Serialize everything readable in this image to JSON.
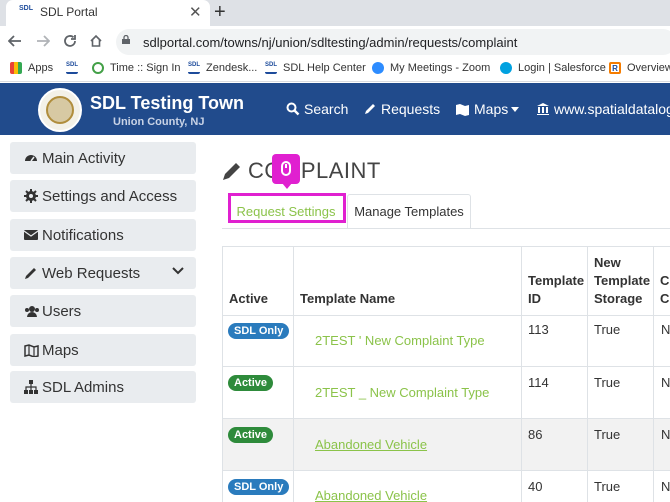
{
  "browser": {
    "tab_title": "SDL Portal",
    "tab_favicon_text": "SDL",
    "new_tab": "+",
    "close": "✕",
    "url": "sdlportal.com/towns/nj/union/sdltesting/admin/requests/complaint"
  },
  "bookmarks": [
    {
      "label": "Apps",
      "icon": "apps-grid-icon"
    },
    {
      "label": "",
      "icon": "sdl-favicon"
    },
    {
      "label": "Time :: Sign In",
      "icon": "clock-icon"
    },
    {
      "label": "Zendesk...",
      "icon": "sdl-favicon"
    },
    {
      "label": "SDL Help Center",
      "icon": "sdl-favicon"
    },
    {
      "label": "My Meetings - Zoom",
      "icon": "zoom-icon"
    },
    {
      "label": "Login | Salesforce",
      "icon": "salesforce-icon"
    },
    {
      "label": "Overview",
      "icon": "r-icon"
    }
  ],
  "site": {
    "title": "SDL Testing Town",
    "subtitle": "Union County, NJ",
    "nav": {
      "search": "Search",
      "requests": "Requests",
      "maps": "Maps",
      "website": "www.spatialdatalogic"
    }
  },
  "sidebar": {
    "items": [
      {
        "label": "Main Activity",
        "icon": "dashboard-icon"
      },
      {
        "label": "Settings and Access",
        "icon": "gear-icon"
      },
      {
        "label": "Notifications",
        "icon": "envelope-icon"
      },
      {
        "label": "Web Requests",
        "icon": "pencil-icon"
      },
      {
        "label": "Users",
        "icon": "users-icon"
      },
      {
        "label": "Maps",
        "icon": "map-icon"
      },
      {
        "label": "SDL Admins",
        "icon": "sitemap-icon"
      }
    ]
  },
  "main": {
    "title": "COMPLAINT",
    "tabs": {
      "request_settings": "Request Settings",
      "manage_templates": "Manage Templates"
    },
    "table": {
      "headers": {
        "active": "Active",
        "template_name": "Template Name",
        "template_id_1": "Template",
        "template_id_2": "ID",
        "storage_1": "New",
        "storage_2": "Template",
        "storage_3": "Storage",
        "extra_1": "C",
        "extra_2": "C"
      },
      "rows": [
        {
          "status": "SDL Only",
          "name": "2TEST ' New Complaint Type",
          "id": "113",
          "storage": "True",
          "extra": "N"
        },
        {
          "status": "Active",
          "name": "2TEST _ New Complaint Type",
          "id": "114",
          "storage": "True",
          "extra": "N"
        },
        {
          "status": "Active",
          "name": "Abandoned Vehicle",
          "id": "86",
          "storage": "True",
          "extra": "N"
        },
        {
          "status": "SDL Only",
          "name": "Abandoned Vehicle",
          "id": "40",
          "storage": "True",
          "extra": "N"
        }
      ]
    }
  },
  "colors": {
    "header_blue": "#214b8c",
    "accent_green": "#8bc34a",
    "highlight_magenta": "#e020d0"
  }
}
